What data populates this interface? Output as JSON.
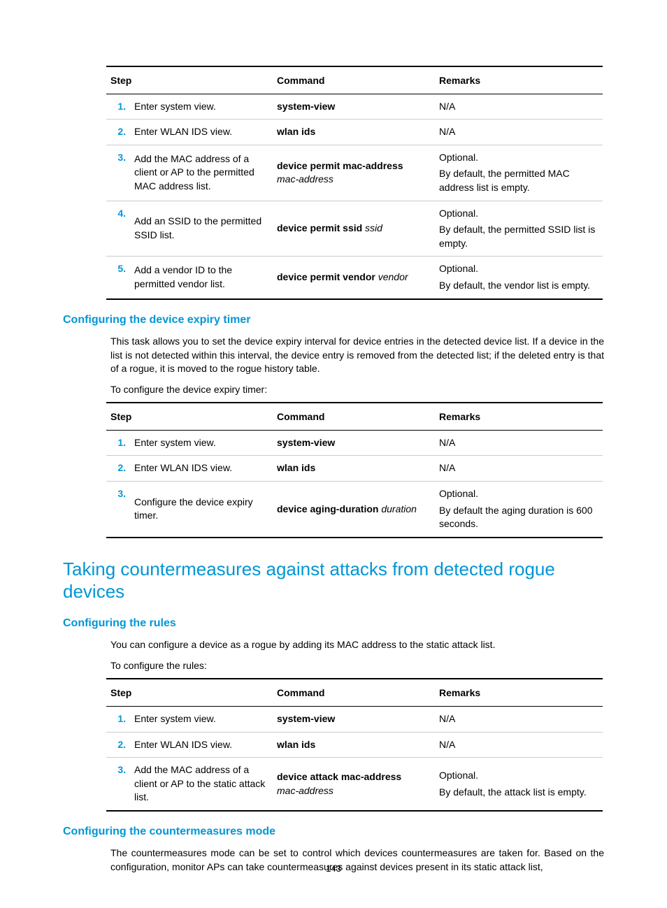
{
  "page_number": "143",
  "table1": {
    "headers": {
      "step": "Step",
      "command": "Command",
      "remarks": "Remarks"
    },
    "rows": [
      {
        "num": "1.",
        "step": "Enter system view.",
        "cmd_bold": "system-view",
        "cmd_ital": "",
        "remarks": [
          "N/A"
        ]
      },
      {
        "num": "2.",
        "step": "Enter WLAN IDS view.",
        "cmd_bold": "wlan ids",
        "cmd_ital": "",
        "remarks": [
          "N/A"
        ]
      },
      {
        "num": "3.",
        "step": "Add the MAC address of a client or AP to the permitted MAC address list.",
        "cmd_bold": "device permit mac-address",
        "cmd_ital": "mac-address",
        "remarks": [
          "Optional.",
          "By default, the permitted MAC address list is empty."
        ]
      },
      {
        "num": "4.",
        "step": "Add an SSID to the permitted SSID list.",
        "cmd_bold": "device permit ssid",
        "cmd_ital": " ssid",
        "remarks": [
          "Optional.",
          "By default, the permitted SSID list is empty."
        ]
      },
      {
        "num": "5.",
        "step": "Add a vendor ID to the permitted vendor list.",
        "cmd_bold": "device permit vendor",
        "cmd_ital": " vendor",
        "remarks": [
          "Optional.",
          "By default, the vendor list is empty."
        ]
      }
    ]
  },
  "h_expiry": "Configuring the device expiry timer",
  "p_expiry_1": "This task allows you to set the device expiry interval for device entries in the detected device list. If a device in the list is not detected within this interval, the device entry is removed from the detected list; if the deleted entry is that of a rogue, it is moved to the rogue history table.",
  "p_expiry_2": "To configure the device expiry timer:",
  "table2": {
    "headers": {
      "step": "Step",
      "command": "Command",
      "remarks": "Remarks"
    },
    "rows": [
      {
        "num": "1.",
        "step": "Enter system view.",
        "cmd_bold": "system-view",
        "cmd_ital": "",
        "remarks": [
          "N/A"
        ]
      },
      {
        "num": "2.",
        "step": "Enter WLAN IDS view.",
        "cmd_bold": "wlan ids",
        "cmd_ital": "",
        "remarks": [
          "N/A"
        ]
      },
      {
        "num": "3.",
        "step": "Configure the device expiry timer.",
        "cmd_bold": "device aging-duration",
        "cmd_ital": " duration",
        "remarks": [
          "Optional.",
          "By default the aging duration is 600 seconds."
        ]
      }
    ]
  },
  "h_counter": "Taking countermeasures against attacks from detected rogue devices",
  "h_rules": "Configuring the rules",
  "p_rules_1": "You can configure a device as a rogue by adding its MAC address to the static attack list.",
  "p_rules_2": "To configure the rules:",
  "table3": {
    "headers": {
      "step": "Step",
      "command": "Command",
      "remarks": "Remarks"
    },
    "rows": [
      {
        "num": "1.",
        "step": "Enter system view.",
        "cmd_bold": "system-view",
        "cmd_ital": "",
        "remarks": [
          "N/A"
        ]
      },
      {
        "num": "2.",
        "step": "Enter WLAN IDS view.",
        "cmd_bold": "wlan ids",
        "cmd_ital": "",
        "remarks": [
          "N/A"
        ]
      },
      {
        "num": "3.",
        "step": "Add the MAC address of a client or AP to the static attack list.",
        "cmd_bold": "device attack mac-address",
        "cmd_ital": "mac-address",
        "remarks": [
          "Optional.",
          "By default, the attack list is empty."
        ]
      }
    ]
  },
  "h_mode": "Configuring the countermeasures mode",
  "p_mode_1": "The countermeasures mode can be set to control which devices countermeasures are taken for. Based on the configuration, monitor APs can take countermeasures against devices present in its static attack list,"
}
